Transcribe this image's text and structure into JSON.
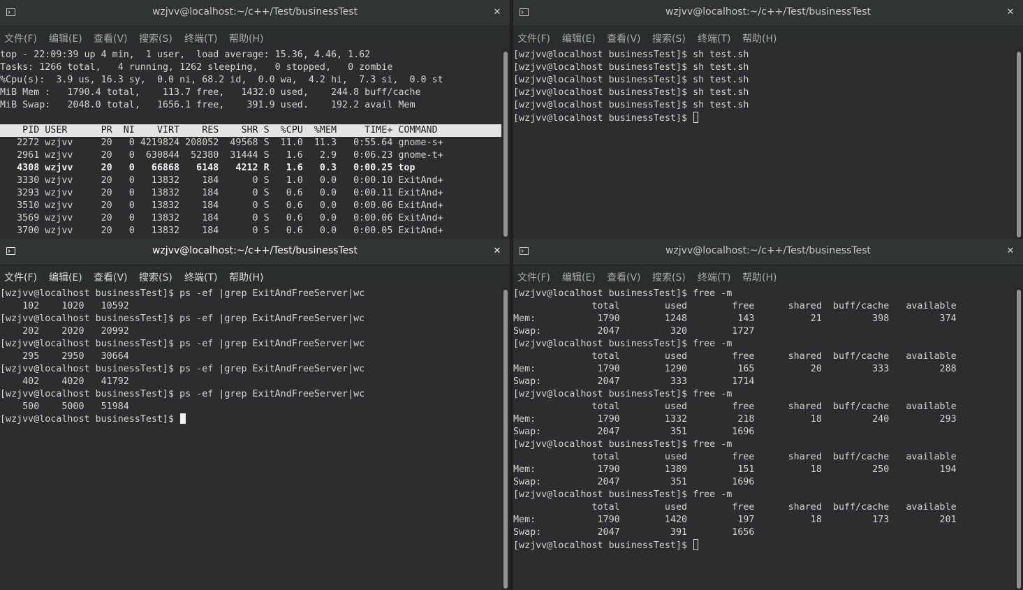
{
  "menu": [
    "文件(F)",
    "编辑(E)",
    "查看(V)",
    "搜索(S)",
    "终端(T)",
    "帮助(H)"
  ],
  "windows": {
    "top_left": {
      "title": "wzjvv@localhost:~/c++/Test/businessTest",
      "lines": [
        "top - 22:09:39 up 4 min,  1 user,  load average: 15.36, 4.46, 1.62",
        "Tasks: 1266 total,   4 running, 1262 sleeping,   0 stopped,   0 zombie",
        "%Cpu(s):  3.9 us, 16.3 sy,  0.0 ni, 68.2 id,  0.0 wa,  4.2 hi,  7.3 si,  0.0 st",
        "MiB Mem :   1790.4 total,    113.7 free,   1432.0 used,    244.8 buff/cache",
        "MiB Swap:   2048.0 total,   1656.1 free,    391.9 used.    192.2 avail Mem",
        "",
        "    PID USER      PR  NI    VIRT    RES    SHR S  %CPU  %MEM     TIME+ COMMAND",
        "   2272 wzjvv     20   0 4219824 208052  49568 S  11.0  11.3   0:55.64 gnome-s+",
        "   2961 wzjvv     20   0  630844  52380  31444 S   1.6   2.9   0:06.23 gnome-t+",
        "   4308 wzjvv     20   0   66868   6148   4212 R   1.6   0.3   0:00.25 top",
        "   3330 wzjvv     20   0   13832    184      0 S   1.0   0.0   0:00.10 ExitAnd+",
        "   3293 wzjvv     20   0   13832    184      0 S   0.6   0.0   0:00.11 ExitAnd+",
        "   3510 wzjvv     20   0   13832    184      0 S   0.6   0.0   0:00.06 ExitAnd+",
        "   3569 wzjvv     20   0   13832    184      0 S   0.6   0.0   0:00.06 ExitAnd+",
        "   3700 wzjvv     20   0   13832    184      0 S   0.6   0.0   0:00.05 ExitAnd+"
      ]
    },
    "top_right": {
      "title": "wzjvv@localhost:~/c++/Test/businessTest",
      "lines": [
        "[wzjvv@localhost businessTest]$ sh test.sh",
        "[wzjvv@localhost businessTest]$ sh test.sh",
        "[wzjvv@localhost businessTest]$ sh test.sh",
        "[wzjvv@localhost businessTest]$ sh test.sh",
        "[wzjvv@localhost businessTest]$ sh test.sh",
        "[wzjvv@localhost businessTest]$ "
      ]
    },
    "bottom_left": {
      "title": "wzjvv@localhost:~/c++/Test/businessTest",
      "lines": [
        "[wzjvv@localhost businessTest]$ ps -ef |grep ExitAndFreeServer|wc",
        "    102    1020   10592",
        "[wzjvv@localhost businessTest]$ ps -ef |grep ExitAndFreeServer|wc",
        "    202    2020   20992",
        "[wzjvv@localhost businessTest]$ ps -ef |grep ExitAndFreeServer|wc",
        "    295    2950   30664",
        "[wzjvv@localhost businessTest]$ ps -ef |grep ExitAndFreeServer|wc",
        "    402    4020   41792",
        "[wzjvv@localhost businessTest]$ ps -ef |grep ExitAndFreeServer|wc",
        "    500    5000   51984",
        "[wzjvv@localhost businessTest]$ "
      ]
    },
    "bottom_right": {
      "title": "wzjvv@localhost:~/c++/Test/businessTest",
      "lines": [
        "[wzjvv@localhost businessTest]$ free -m",
        "              total        used        free      shared  buff/cache   available",
        "Mem:           1790        1248         143          21         398         374",
        "Swap:          2047         320        1727",
        "[wzjvv@localhost businessTest]$ free -m",
        "              total        used        free      shared  buff/cache   available",
        "Mem:           1790        1290         165          20         333         288",
        "Swap:          2047         333        1714",
        "[wzjvv@localhost businessTest]$ free -m",
        "              total        used        free      shared  buff/cache   available",
        "Mem:           1790        1332         218          18         240         293",
        "Swap:          2047         351        1696",
        "[wzjvv@localhost businessTest]$ free -m",
        "              total        used        free      shared  buff/cache   available",
        "Mem:           1790        1389         151          18         250         194",
        "Swap:          2047         351        1696",
        "[wzjvv@localhost businessTest]$ free -m",
        "              total        used        free      shared  buff/cache   available",
        "Mem:           1790        1420         197          18         173         201",
        "Swap:          2047         391        1656",
        "[wzjvv@localhost businessTest]$ "
      ]
    }
  }
}
